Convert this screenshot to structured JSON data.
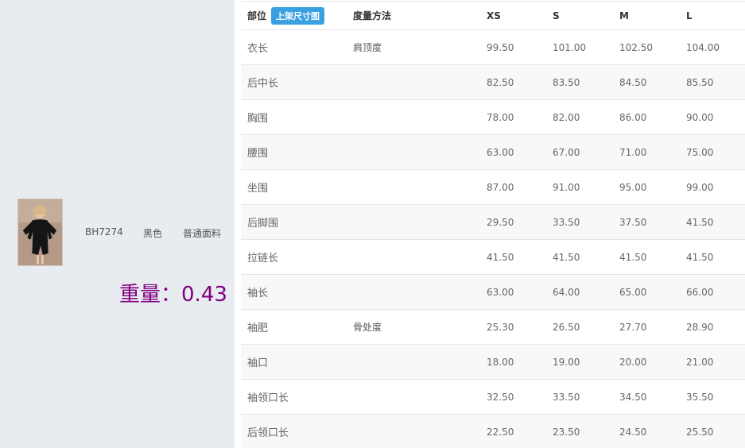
{
  "product": {
    "code": "BH7274",
    "color": "黑色",
    "fabric": "普通面料",
    "weight_label": "重量：",
    "weight_value": "0.43"
  },
  "table": {
    "headers": {
      "part": "部位",
      "size_chart_button": "上架尺寸图",
      "method": "度量方法",
      "xs": "XS",
      "s": "S",
      "m": "M",
      "l": "L"
    },
    "rows": [
      {
        "part": "衣长",
        "method": "肩顶度",
        "xs": "99.50",
        "s": "101.00",
        "m": "102.50",
        "l": "104.00"
      },
      {
        "part": "后中长",
        "method": "",
        "xs": "82.50",
        "s": "83.50",
        "m": "84.50",
        "l": "85.50"
      },
      {
        "part": "胸围",
        "method": "",
        "xs": "78.00",
        "s": "82.00",
        "m": "86.00",
        "l": "90.00"
      },
      {
        "part": "腰围",
        "method": "",
        "xs": "63.00",
        "s": "67.00",
        "m": "71.00",
        "l": "75.00"
      },
      {
        "part": "坐围",
        "method": "",
        "xs": "87.00",
        "s": "91.00",
        "m": "95.00",
        "l": "99.00"
      },
      {
        "part": "后脚围",
        "method": "",
        "xs": "29.50",
        "s": "33.50",
        "m": "37.50",
        "l": "41.50"
      },
      {
        "part": "拉链长",
        "method": "",
        "xs": "41.50",
        "s": "41.50",
        "m": "41.50",
        "l": "41.50"
      },
      {
        "part": "袖长",
        "method": "",
        "xs": "63.00",
        "s": "64.00",
        "m": "65.00",
        "l": "66.00"
      },
      {
        "part": "袖肥",
        "method": "骨处度",
        "xs": "25.30",
        "s": "26.50",
        "m": "27.70",
        "l": "28.90"
      },
      {
        "part": "袖口",
        "method": "",
        "xs": "18.00",
        "s": "19.00",
        "m": "20.00",
        "l": "21.00"
      },
      {
        "part": "袖领口长",
        "method": "",
        "xs": "32.50",
        "s": "33.50",
        "m": "34.50",
        "l": "35.50"
      },
      {
        "part": "后领口长",
        "method": "",
        "xs": "22.50",
        "s": "23.50",
        "m": "24.50",
        "l": "25.50"
      }
    ]
  },
  "colors": {
    "weight": "#800080",
    "button": "#3aa0e2",
    "panel": "#e8ebef"
  }
}
